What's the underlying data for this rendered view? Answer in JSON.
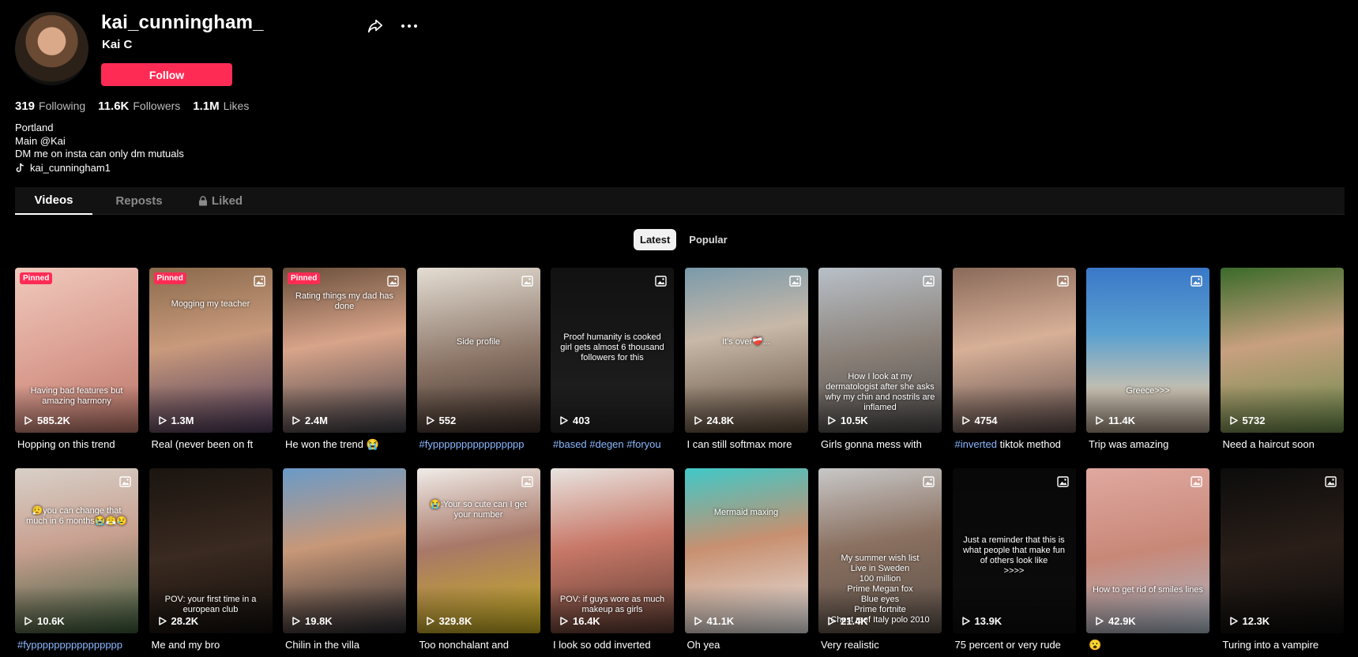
{
  "profile": {
    "username": "kai_cunningham_",
    "nickname": "Kai C",
    "follow_label": "Follow",
    "stats": [
      {
        "value": "319",
        "label": "Following"
      },
      {
        "value": "11.6K",
        "label": "Followers"
      },
      {
        "value": "1.1M",
        "label": "Likes"
      }
    ],
    "bio": [
      "Portland",
      "Main @Kai",
      "DM me on insta can only dm mutuals"
    ],
    "link": "kai_cunningham1"
  },
  "tabs": [
    "Videos",
    "Reposts",
    "Liked"
  ],
  "sort": {
    "latest": "Latest",
    "popular": "Popular"
  },
  "videos": [
    {
      "pinned": "Pinned",
      "overlay": "Having bad features but amazing harmony",
      "plays": "585.2K",
      "caption": "Hopping on this trend",
      "tag": "",
      "bg": "linear-gradient(160deg,#f0c9bd,#d99c8f 55%,#b77468)"
    },
    {
      "pinned": "Pinned",
      "overlay": "Mogging my teacher",
      "plays": "1.3M",
      "caption": "Real (never been on ft",
      "tag": "",
      "bg": "linear-gradient(170deg,#8b6a4c,#c99a7c 45%,#4c3a5a)"
    },
    {
      "pinned": "Pinned",
      "overlay": "Rating things my dad has done",
      "plays": "2.4M",
      "caption": "He won the trend 😭",
      "tag": "",
      "bg": "linear-gradient(170deg,#6a4f3b,#d8a48a 45%,#3c3c44)"
    },
    {
      "pinned": "",
      "overlay": "Side profile",
      "plays": "552",
      "caption": "",
      "tag": "#fypppppppppppppppp",
      "bg": "linear-gradient(170deg,#e4ddd3,#8a7466 55%,#3d2f28)"
    },
    {
      "pinned": "",
      "overlay": "Proof humanity is cooked girl gets almost 6 thousand followers for this",
      "plays": "403",
      "caption": "",
      "tag": "#based #degen #foryou",
      "bg": "linear-gradient(180deg,#111,#1a1a1a 60%,#222)"
    },
    {
      "pinned": "",
      "overlay": "It's over❤️‍🩹...",
      "plays": "24.8K",
      "caption": "I can still softmax more",
      "tag": "",
      "bg": "linear-gradient(170deg,#7a9aaa,#c8b8a8 40%,#5a4838)"
    },
    {
      "pinned": "",
      "overlay": "How I look at my dermatologist after she asks why my chin and nostrils are inflamed",
      "plays": "10.5K",
      "caption": "Girls gonna mess with",
      "tag": "",
      "bg": "linear-gradient(170deg,#b8c0c8,#8a8078 50%,#4a4848)"
    },
    {
      "pinned": "",
      "overlay": "",
      "plays": "4754",
      "caption": " tiktok method",
      "tag": "#inverted",
      "bg": "linear-gradient(170deg,#8a6a5a,#d8b098 45%,#5a4a48)"
    },
    {
      "pinned": "",
      "overlay": "Greece>>>",
      "plays": "11.4K",
      "caption": "Trip was amazing",
      "tag": "",
      "bg": "linear-gradient(180deg,#3a78c8,#5aa0d0 40%,#c8c0b0 75%,#a89888)"
    },
    {
      "pinned": "",
      "overlay": "",
      "plays": "5732",
      "caption": "Need a haircut soon",
      "tag": "",
      "bg": "linear-gradient(170deg,#3a6a2a,#c8a080 45%,#6a8a4a)"
    },
    {
      "pinned": "",
      "overlay": "😮‍💨you can change that much in 6 months😭😤😢",
      "plays": "10.6K",
      "caption": "",
      "tag": "#fypppppppppppppppp",
      "bg": "linear-gradient(170deg,#d8d0c8,#c8a090 45%,#3a5a3a)"
    },
    {
      "pinned": "",
      "overlay": "POV: your first time in a european club",
      "plays": "28.2K",
      "caption": "Me and my bro",
      "tag": "",
      "bg": "linear-gradient(170deg,#1a1410,#3a2a20 50%,#120e0c)"
    },
    {
      "pinned": "",
      "overlay": "",
      "plays": "19.8K",
      "caption": "Chilin in the villa",
      "tag": "",
      "bg": "linear-gradient(170deg,#6a9ac8,#c89878 45%,#2a2a30)"
    },
    {
      "pinned": "",
      "overlay": "😭:Your so cute can I get your number",
      "plays": "329.8K",
      "caption": "Too nonchalant and",
      "tag": "",
      "bg": "linear-gradient(170deg,#f0ece8,#a87868 45%,#c8b020)"
    },
    {
      "pinned": "",
      "overlay": "POV: if guys wore as much makeup as girls",
      "plays": "16.4K",
      "caption": "I look so odd inverted",
      "tag": "",
      "bg": "linear-gradient(170deg,#e8e4e0,#c87868 45%,#5a3a30)"
    },
    {
      "pinned": "",
      "overlay": "Mermaid maxing",
      "plays": "41.1K",
      "caption": "Oh yea",
      "tag": "",
      "bg": "linear-gradient(170deg,#40c8c8,#c89070 45%,#e8e8e8)"
    },
    {
      "pinned": "",
      "overlay": "My summer wish list\nLive in Sweden\n100 million\nPrime Megan fox\nBlue eyes\nPrime fortnite\nChest reef Italy polo 2010",
      "plays": "21.4K",
      "caption": "Very realistic",
      "tag": "",
      "bg": "linear-gradient(170deg,#c8c8c8,#8a7060 45%,#5a5048)"
    },
    {
      "pinned": "",
      "overlay": "Just a reminder that this is what people that make fun of others look like\n>>>>",
      "plays": "13.9K",
      "caption": "75 percent or very rude",
      "tag": "",
      "bg": "linear-gradient(180deg,#080808,#0c0c0c)"
    },
    {
      "pinned": "",
      "overlay": "How to get rid of smiles lines",
      "plays": "42.9K",
      "caption": "😮",
      "tag": "",
      "bg": "linear-gradient(170deg,#e0a8a0,#c88878 50%,#a8b8c8)"
    },
    {
      "pinned": "",
      "overlay": "",
      "plays": "12.3K",
      "caption": "Turing into a vampire",
      "tag": "",
      "bg": "linear-gradient(170deg,#0c0c0c,#2a1e18 50%,#0a0a0a)"
    }
  ],
  "colors": {
    "accent": "#fe2c55",
    "tag": "#8bb8ff",
    "background": "#000000"
  },
  "icons": {
    "share": "share-icon",
    "more": "more-icon",
    "lock": "lock-icon",
    "play": "play-icon",
    "photo": "photo-icon",
    "link": "tiktok-link-icon"
  }
}
